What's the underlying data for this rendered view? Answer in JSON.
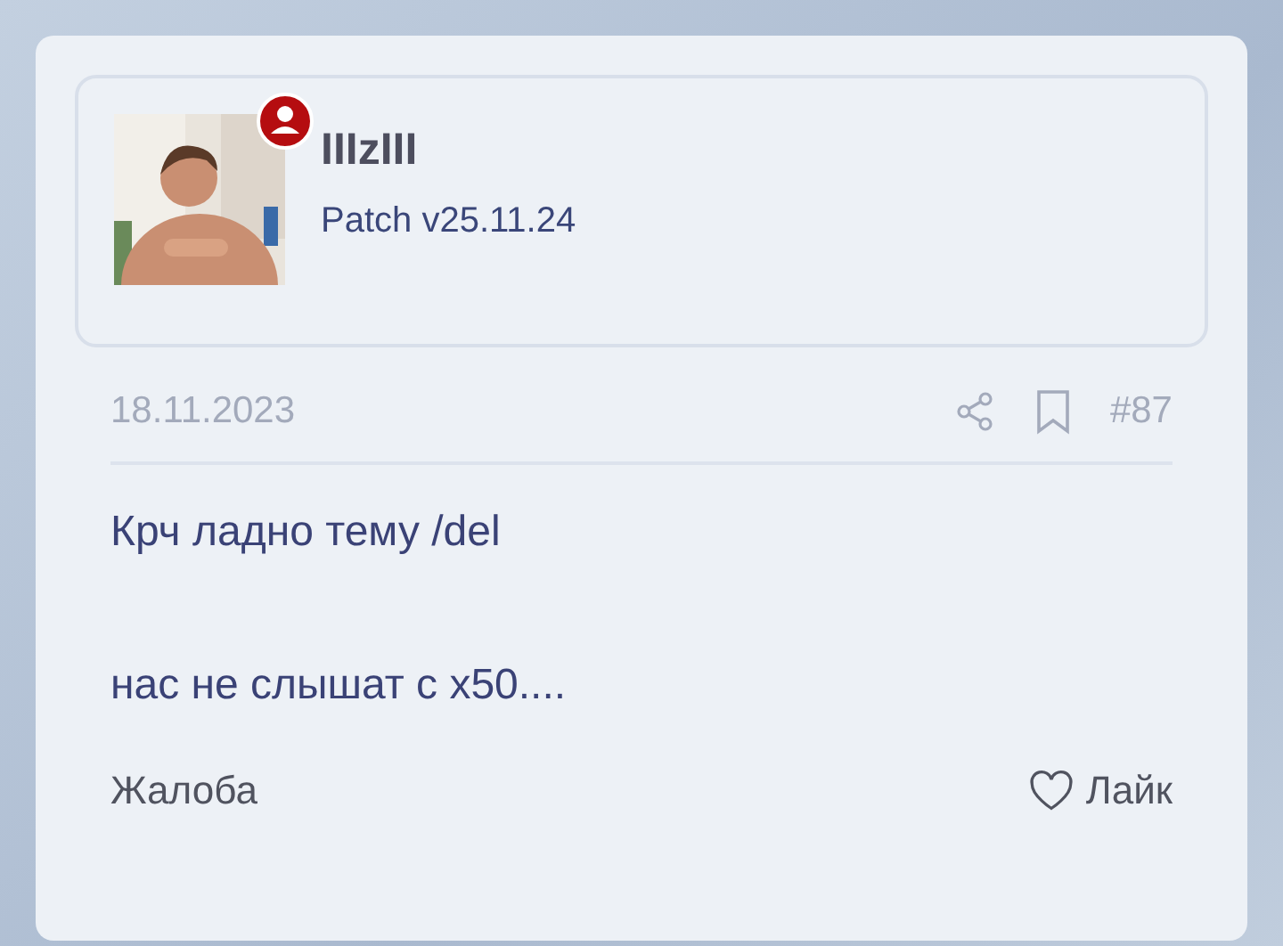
{
  "author": {
    "name": "IIIzIII",
    "title": "Patch v25.11.24"
  },
  "post": {
    "date": "18.11.2023",
    "number": "#87",
    "bookmarked": false,
    "lines": [
      "Крч ладно тему /del",
      "нас не слышат с x50...."
    ]
  },
  "footer": {
    "report": "Жалоба",
    "like": "Лайк",
    "liked": false
  }
}
